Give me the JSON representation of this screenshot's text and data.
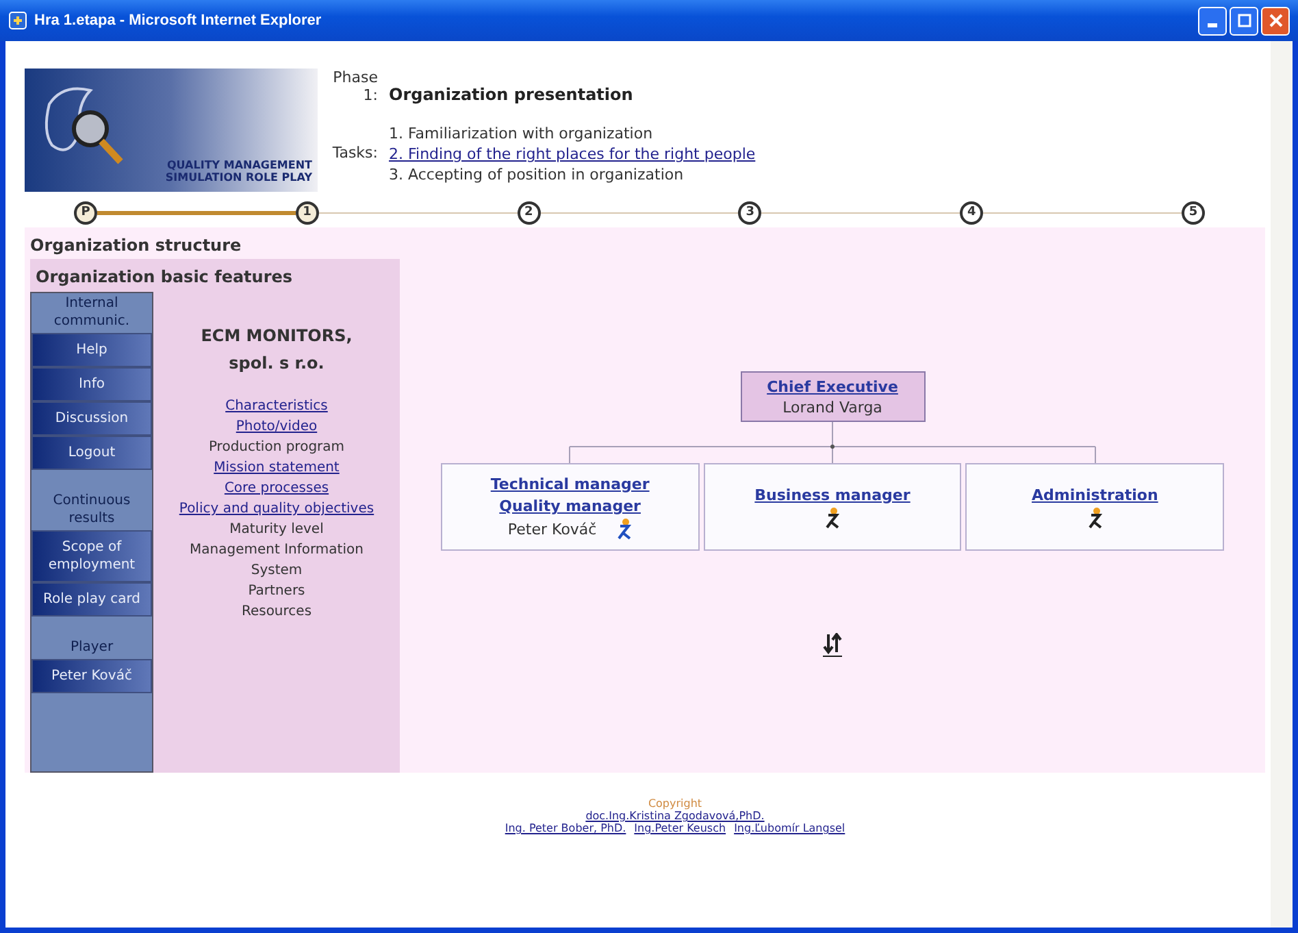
{
  "window": {
    "title": "Hra 1.etapa - Microsoft Internet Explorer"
  },
  "logo": {
    "line1": "QUALITY MANAGEMENT",
    "line2": "SIMULATION ROLE PLAY"
  },
  "phase": {
    "label": "Phase 1:",
    "title": "Organization presentation",
    "tasks_label": "Tasks:",
    "tasks": [
      {
        "text": "1. Familiarization with organization",
        "link": false
      },
      {
        "text": "2. Finding of the right places for the right people",
        "link": true
      },
      {
        "text": "3. Accepting of position in organization",
        "link": false
      }
    ]
  },
  "steps": [
    {
      "label": "P",
      "reached": true
    },
    {
      "label": "1",
      "reached": true
    },
    {
      "label": "2",
      "reached": false
    },
    {
      "label": "3",
      "reached": false
    },
    {
      "label": "4",
      "reached": false
    },
    {
      "label": "5",
      "reached": false
    }
  ],
  "section_title": "Organization structure",
  "panel_title": "Organization basic features",
  "nav": [
    {
      "kind": "header",
      "label": "Internal communic."
    },
    {
      "kind": "button",
      "label": "Help"
    },
    {
      "kind": "button",
      "label": "Info"
    },
    {
      "kind": "button",
      "label": "Discussion"
    },
    {
      "kind": "button",
      "label": "Logout"
    },
    {
      "kind": "header",
      "label": "Continuous results"
    },
    {
      "kind": "button",
      "label": "Scope of employment"
    },
    {
      "kind": "button",
      "label": "Role play card"
    },
    {
      "kind": "header",
      "label": "Player"
    },
    {
      "kind": "button",
      "label": "Peter Kováč"
    }
  ],
  "company": {
    "name": "ECM MONITORS, spol. s r.o.",
    "items": [
      {
        "text": "Characteristics",
        "link": true
      },
      {
        "text": "Photo/video",
        "link": true
      },
      {
        "text": "Production program",
        "link": false
      },
      {
        "text": "Mission statement",
        "link": true
      },
      {
        "text": "Core processes",
        "link": true
      },
      {
        "text": "Policy and quality objectives",
        "link": true
      },
      {
        "text": "Maturity level",
        "link": false
      },
      {
        "text": "Management Information System",
        "link": false
      },
      {
        "text": "Partners",
        "link": false
      },
      {
        "text": "Resources",
        "link": false
      }
    ]
  },
  "org_chart": {
    "chief": {
      "title": "Chief Executive",
      "name": "Lorand Varga"
    },
    "departments": [
      {
        "titles": [
          "Technical manager",
          "Quality manager"
        ],
        "name": "Peter Kováč"
      },
      {
        "titles": [
          "Business manager"
        ]
      },
      {
        "titles": [
          "Administration"
        ]
      }
    ]
  },
  "footer": {
    "copyright": "Copyright",
    "authors": [
      "doc.Ing.Kristina Zgodavová,PhD.",
      "Ing. Peter Bober, PhD.",
      "Ing.Peter Keusch",
      "Ing.Ľubomír Langsel"
    ]
  }
}
